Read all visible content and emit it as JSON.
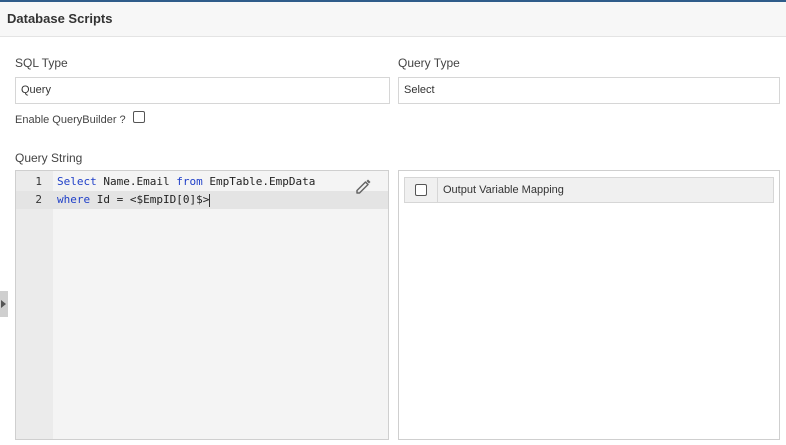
{
  "header": {
    "title": "Database Scripts"
  },
  "form": {
    "sql_type": {
      "label": "SQL Type",
      "value": "Query"
    },
    "query_type": {
      "label": "Query Type",
      "value": "Select"
    },
    "enable_query_builder": {
      "label": "Enable QueryBuilder ?",
      "checked": false
    },
    "query_string_label": "Query String"
  },
  "editor": {
    "lines": [
      {
        "number": "1",
        "tokens": [
          {
            "text": "Select",
            "kw": true
          },
          {
            "text": " Name.Email ",
            "kw": false
          },
          {
            "text": "from",
            "kw": true
          },
          {
            "text": " EmpTable.EmpData",
            "kw": false
          }
        ]
      },
      {
        "number": "2",
        "tokens": [
          {
            "text": "where",
            "kw": true
          },
          {
            "text": " Id = <$EmpID[0]$>",
            "kw": false
          }
        ]
      }
    ],
    "active_line": 2,
    "edit_icon": "pencil-icon"
  },
  "mapping": {
    "header_label": "Output Variable Mapping",
    "select_all_checked": false
  }
}
